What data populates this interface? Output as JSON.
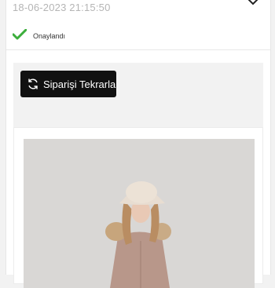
{
  "order": {
    "datetime": "18-06-2023 21:15:50",
    "status_label": "Onaylandı",
    "reorder_label": "Siparişi Tekrarla",
    "product_image_alt": ""
  },
  "icons": {
    "expand": "chevron-down-icon",
    "status": "checkmark-icon",
    "reorder": "refresh-icon"
  },
  "colors": {
    "status_check": "#3cae3c",
    "button_bg": "#111111"
  }
}
